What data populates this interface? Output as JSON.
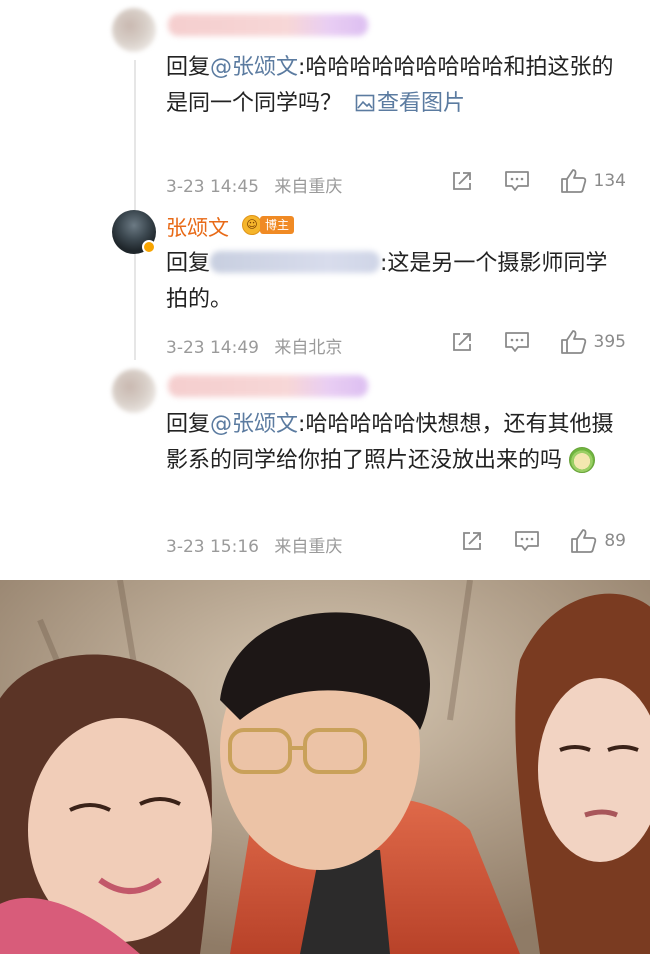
{
  "comments": [
    {
      "prefix": "回复",
      "mention": "@张颂文",
      "text": ":哈哈哈哈哈哈哈哈哈和拍这张的是同一个同学吗？",
      "link": "查看图片",
      "time": "3-23 14:45",
      "source": "来自重庆",
      "likes": "134"
    },
    {
      "author": "张颂文",
      "badge": "博主",
      "prefix": "回复",
      "text": ":这是另一个摄影师同学拍的。",
      "time": "3-23 14:49",
      "source": "来自北京",
      "likes": "395"
    },
    {
      "prefix": "回复",
      "mention": "@张颂文",
      "text": ":哈哈哈哈哈快想想，还有其他摄影系的同学给你拍了照片还没放出来的吗",
      "time": "3-23 15:16",
      "source": "来自重庆",
      "likes": "89"
    }
  ],
  "icons": {
    "share": "share-icon",
    "comment": "comment-icon",
    "like": "thumbs-up-icon",
    "image": "image-icon"
  },
  "colors": {
    "author_name": "#e86a17",
    "link": "#5b7ba0",
    "meta": "#9a9a9a"
  }
}
